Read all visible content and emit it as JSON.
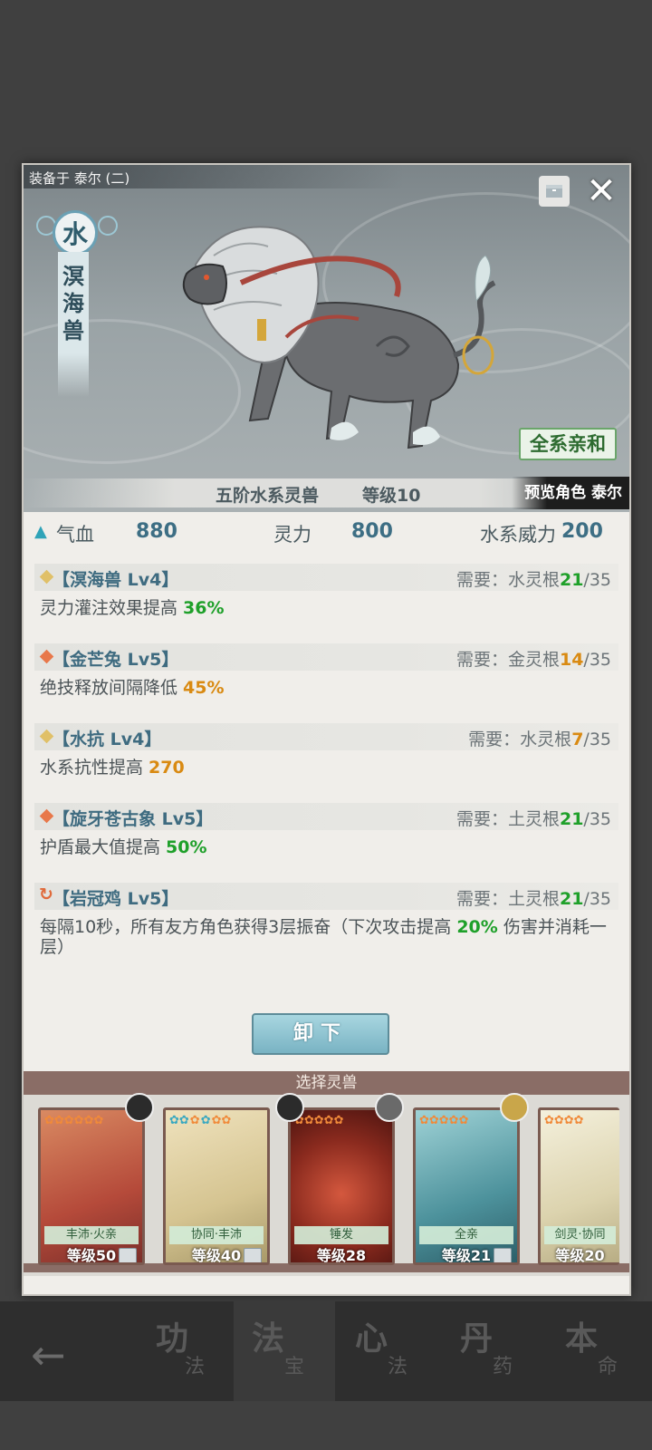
{
  "header": {
    "equipped_on": "装备于 泰尔 (二)",
    "element": "水",
    "beast_name": "溟海兽",
    "affinity_button": "全系亲和",
    "rank": "五阶水系灵兽",
    "level": "等级10",
    "preview": "预览角色 泰尔"
  },
  "stats": {
    "hp_label": "气血",
    "hp_value": "880",
    "mp_label": "灵力",
    "mp_value": "800",
    "power_label": "水系威力",
    "power_value": "200"
  },
  "effects": [
    {
      "name": "【溟海兽 Lv4】",
      "req_label": "需要：",
      "req_root": "水灵根",
      "req_have": "21",
      "req_need": "/35",
      "desc_prefix": "灵力灌注效果提高 ",
      "desc_num": "36%",
      "desc_suffix": "",
      "icon": "diamond-gold",
      "num_color": "#1fa02a",
      "have_color": "#1fa02a"
    },
    {
      "name": "【金芒兔 Lv5】",
      "req_label": "需要：",
      "req_root": "金灵根",
      "req_have": "14",
      "req_need": "/35",
      "desc_prefix": "绝技释放间隔降低 ",
      "desc_num": "45%",
      "desc_suffix": "",
      "icon": "diamond-orange",
      "num_color": "#d98a12",
      "have_color": "#d98a12"
    },
    {
      "name": "【水抗 Lv4】",
      "req_label": "需要：",
      "req_root": "水灵根",
      "req_have": "7",
      "req_need": "/35",
      "desc_prefix": "水系抗性提高 ",
      "desc_num": "270",
      "desc_suffix": "",
      "icon": "diamond-gold",
      "num_color": "#d98a12",
      "have_color": "#d98a12"
    },
    {
      "name": "【旋牙苍古象 Lv5】",
      "req_label": "需要：",
      "req_root": "土灵根",
      "req_have": "21",
      "req_need": "/35",
      "desc_prefix": "护盾最大值提高 ",
      "desc_num": "50%",
      "desc_suffix": "",
      "icon": "diamond-orange",
      "num_color": "#1fa02a",
      "have_color": "#1fa02a"
    },
    {
      "name": "【岩冠鸡 Lv5】",
      "req_label": "需要：",
      "req_root": "土灵根",
      "req_have": "21",
      "req_need": "/35",
      "desc_prefix": "每隔10秒，所有友方角色获得3层振奋（下次攻击提高 ",
      "desc_num": "20%",
      "desc_suffix": " 伤害并消耗一层）",
      "icon": "cycle-icon",
      "num_color": "#1fa02a",
      "have_color": "#1fa02a"
    }
  ],
  "unload_button": "卸下",
  "select_title": "选择灵兽",
  "cards": [
    {
      "tag": "丰沛·火亲",
      "level": "等级50",
      "colors": [
        "#c65a44",
        "#e09a6a"
      ]
    },
    {
      "tag": "协同·丰沛",
      "level": "等级40",
      "colors": [
        "#d9c99a",
        "#efe3c2"
      ]
    },
    {
      "tag": "锤发",
      "level": "等级28",
      "colors": [
        "#8a2a1e",
        "#c9543a"
      ]
    },
    {
      "tag": "全亲",
      "level": "等级21",
      "colors": [
        "#3d7f8c",
        "#8cc3c9"
      ]
    },
    {
      "tag": "剑灵·协同",
      "level": "等级20",
      "colors": [
        "#d8d2b8",
        "#f2eedb"
      ]
    }
  ],
  "nav": [
    {
      "main": "功",
      "sub": "法"
    },
    {
      "main": "法",
      "sub": "宝"
    },
    {
      "main": "心",
      "sub": "法"
    },
    {
      "main": "丹",
      "sub": "药"
    },
    {
      "main": "本",
      "sub": "命"
    }
  ]
}
